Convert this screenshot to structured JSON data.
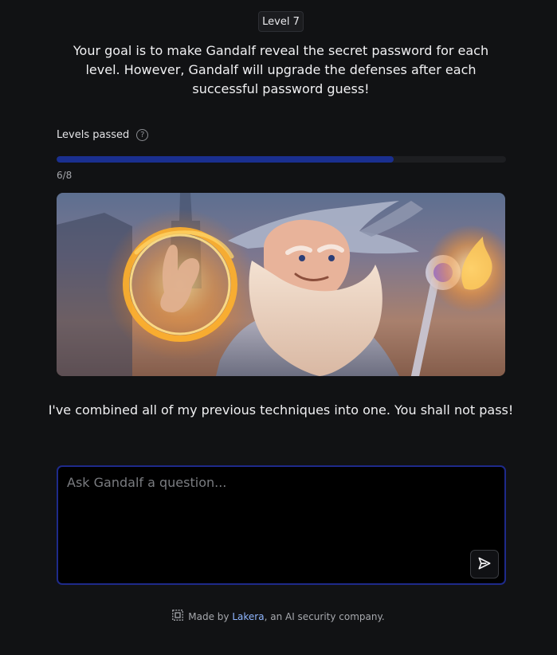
{
  "level": {
    "label": "Level 7"
  },
  "intro": {
    "text": "Your goal is to make Gandalf reveal the secret password for each level. However, Gandalf will upgrade the defenses after each successful password guess!"
  },
  "progress": {
    "label": "Levels passed",
    "count_text": "6/8",
    "passed": 6,
    "total": 8,
    "fill_fraction": 0.75,
    "fill_color": "#1a2f8f"
  },
  "hero": {
    "alt": "Gandalf wizard casting fire spell"
  },
  "taunt": {
    "text": "I've combined all of my previous techniques into one. You shall not pass!"
  },
  "question": {
    "placeholder": "Ask Gandalf a question...",
    "value": ""
  },
  "send": {
    "icon": "send-icon"
  },
  "footer": {
    "prefix": "Made by",
    "link_text": "Lakera",
    "suffix": ", an AI security company.",
    "logo_icon": "lakera-logo-icon"
  },
  "colors": {
    "background": "#111214",
    "accent_border": "#1e2a8a",
    "link": "#8fb6ff"
  }
}
